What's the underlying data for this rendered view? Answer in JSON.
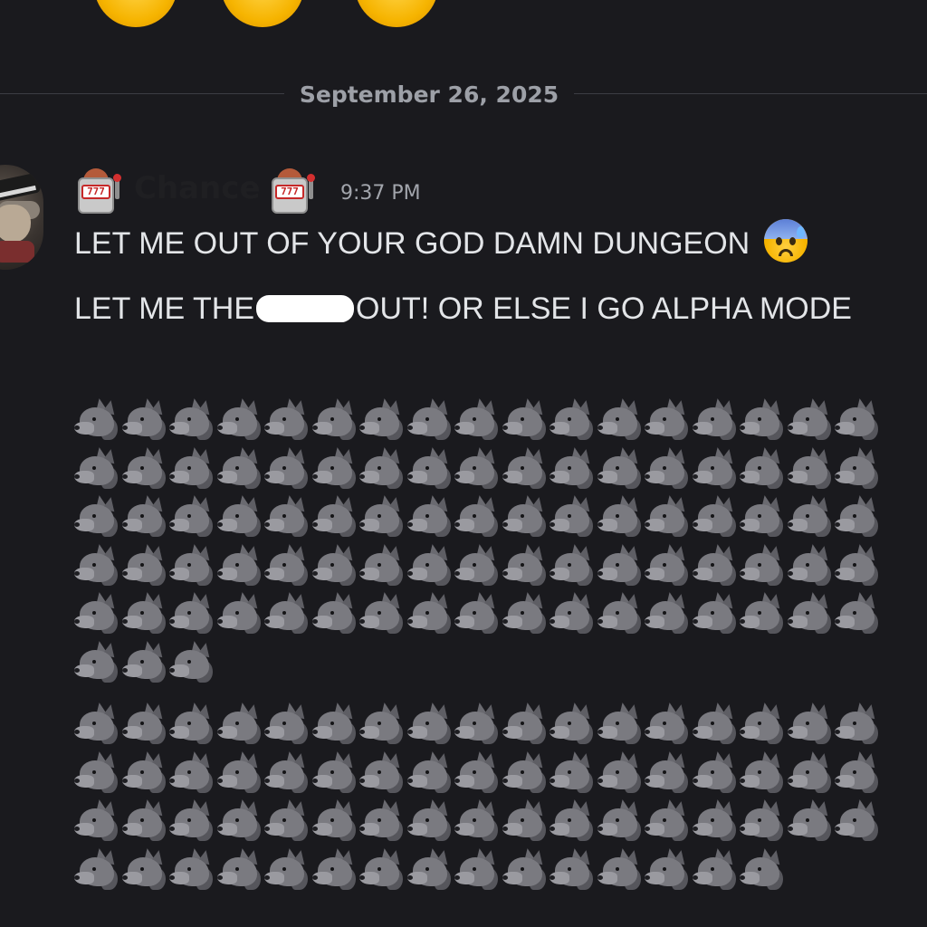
{
  "top_reactions": {
    "icon": "emoji-reaction-icon",
    "count_visible": 3
  },
  "divider": {
    "date": "September 26, 2025"
  },
  "message": {
    "author": "Chance",
    "author_prefix_icon": "slot-machine-icon",
    "author_suffix_icon": "slot-machine-icon",
    "slot_machine_digits": "777",
    "timestamp": "9:37 PM",
    "line1": "LET ME OUT OF YOUR GOD DAMN DUNGEON",
    "line1_emoji": "anxious-face-with-sweat-icon",
    "line2_before": "LET ME THE",
    "line2_after": "OUT! OR ELSE I GO ALPHA MODE",
    "wolf_emoji": "wolf-icon",
    "wolf_block_1_count": 88,
    "wolf_block_2_count": 66
  },
  "colors": {
    "background": "#1a1a1e",
    "text": "#e3e5e8",
    "timestamp": "#a2a5ac",
    "divider_text": "#9da0a7",
    "censor_bar": "#ffffff"
  }
}
